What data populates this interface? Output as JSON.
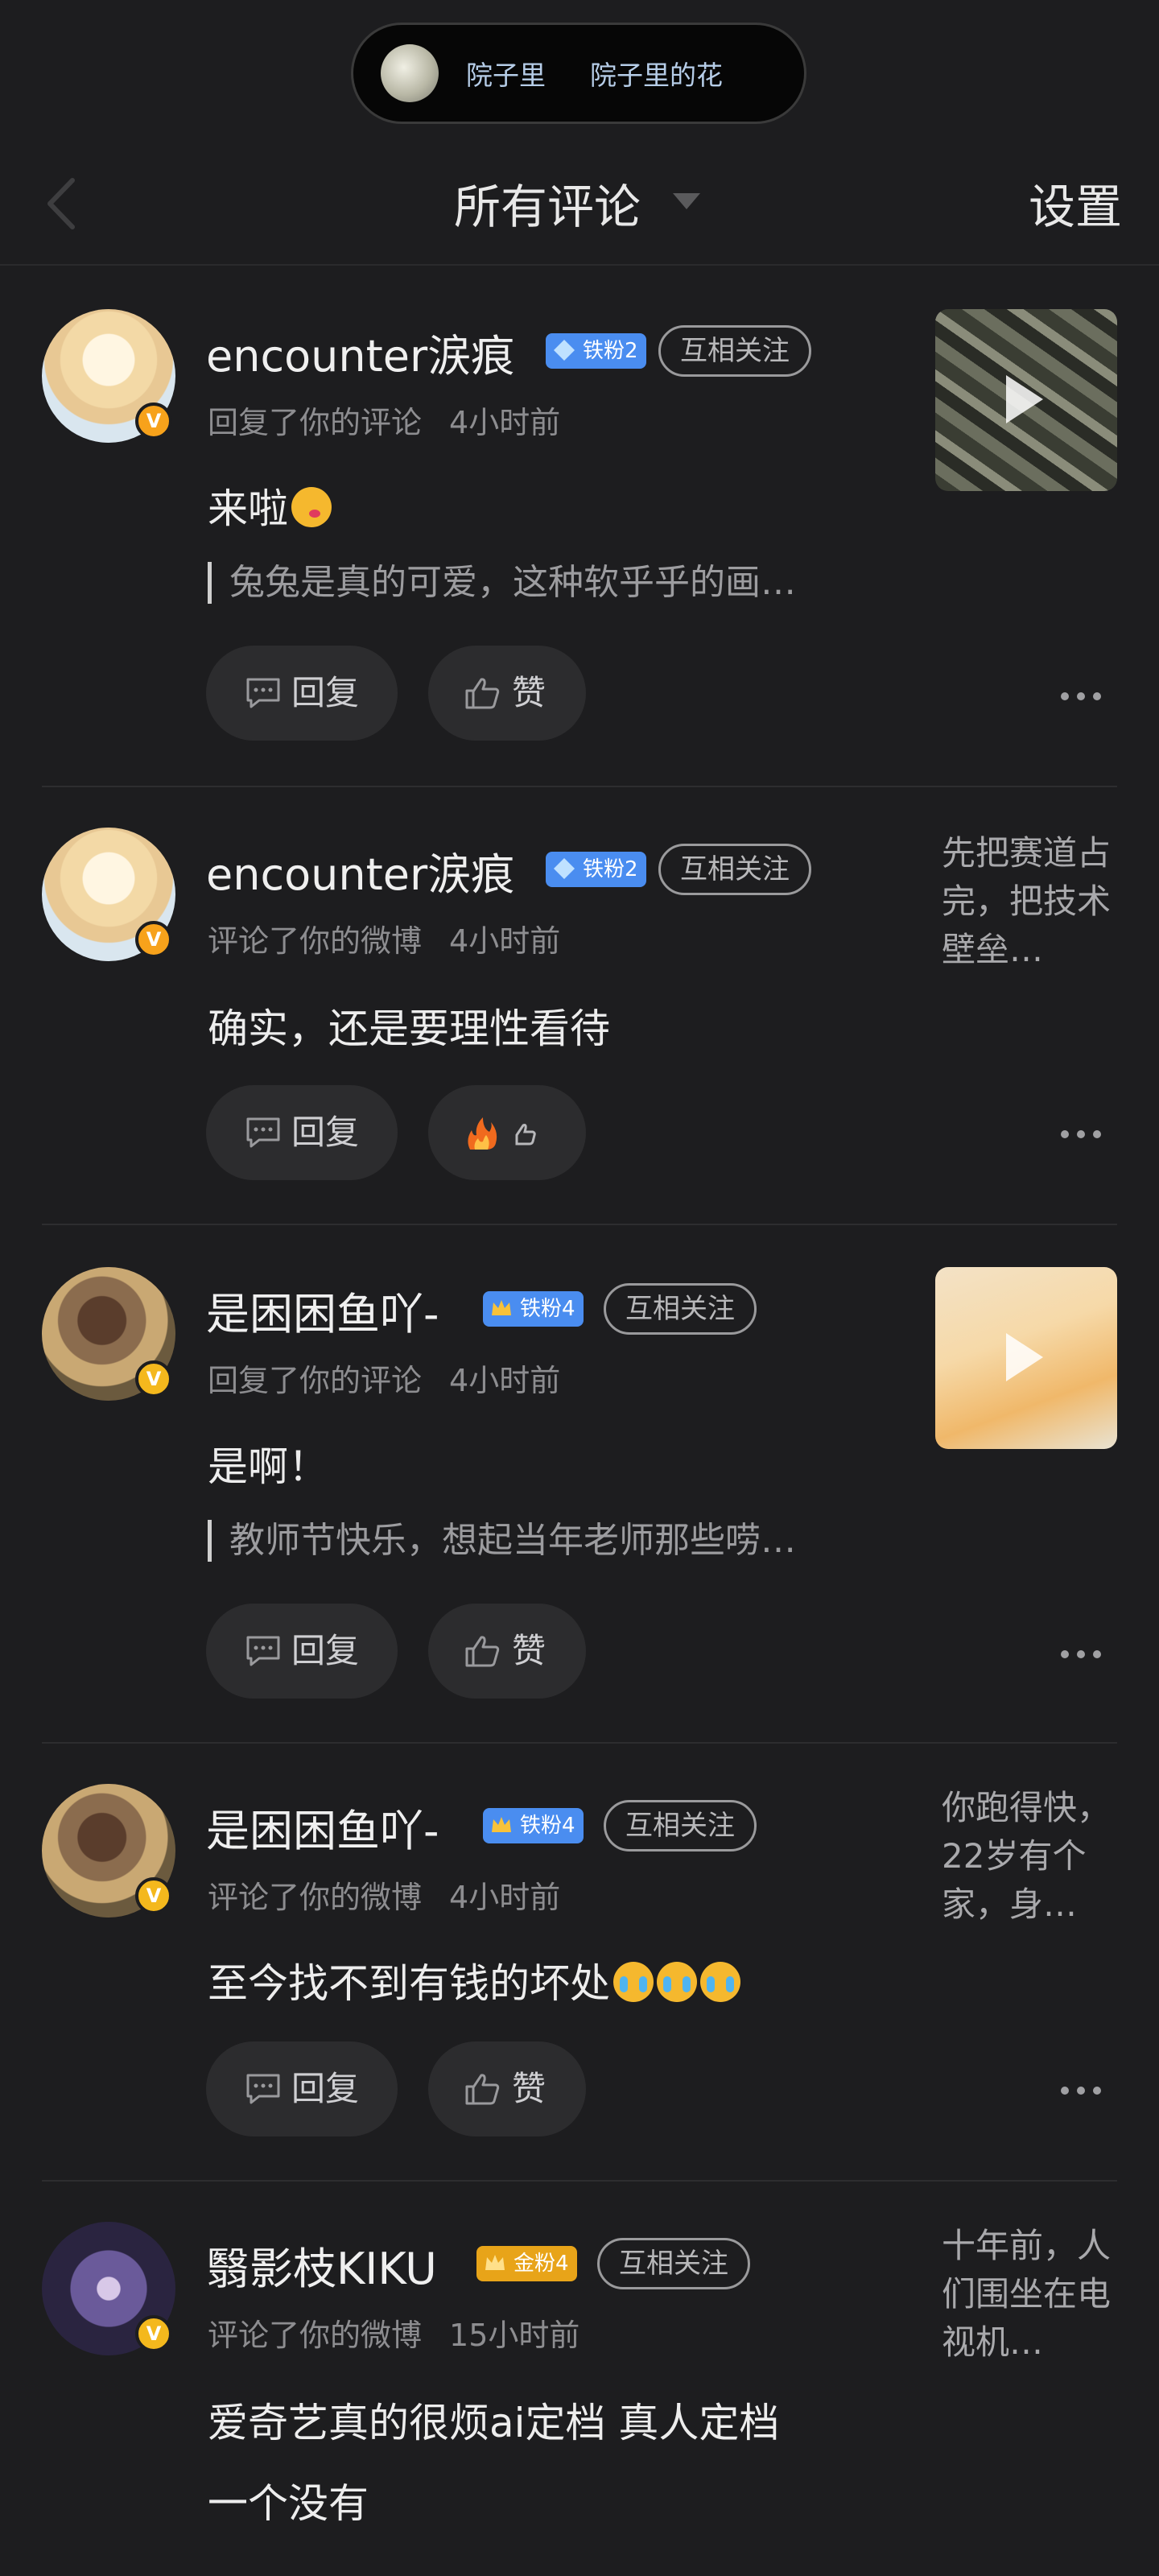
{
  "top_pill": {
    "text1": "院子里",
    "text2": "院子里的花"
  },
  "header": {
    "title": "所有评论",
    "settings": "设置"
  },
  "items": [
    {
      "username": "encounter涙痕",
      "fan_badge": "铁粉2",
      "follow_label": "互相关注",
      "action": "回复了你的评论",
      "time": "4小时前",
      "content": "来啦",
      "quote": "兔兔是真的可爱，这种软乎乎的画…",
      "reply_label": "回复",
      "like_label": "赞",
      "thumbnail": "video-thumbnail-camo"
    },
    {
      "username": "encounter涙痕",
      "fan_badge": "铁粉2",
      "follow_label": "互相关注",
      "action": "评论了你的微博",
      "time": "4小时前",
      "content": "确实，还是要理性看待",
      "reply_label": "回复",
      "side_text": "先把赛道占完，把技术壁垒…"
    },
    {
      "username": "是困困鱼吖-",
      "fan_badge": "铁粉4",
      "follow_label": "互相关注",
      "action": "回复了你的评论",
      "time": "4小时前",
      "content": "是啊！",
      "quote": "教师节快乐，想起当年老师那些唠…",
      "reply_label": "回复",
      "like_label": "赞",
      "thumbnail": "video-thumbnail-flowers"
    },
    {
      "username": "是困困鱼吖-",
      "fan_badge": "铁粉4",
      "follow_label": "互相关注",
      "action": "评论了你的微博",
      "time": "4小时前",
      "content": "至今找不到有钱的坏处",
      "reply_label": "回复",
      "like_label": "赞",
      "side_text": "你跑得快，22岁有个家，身…"
    },
    {
      "username": "翳影枝KIKU",
      "fan_badge": "金粉4",
      "follow_label": "互相关注",
      "action": "评论了你的微博",
      "time": "15小时前",
      "content": "爱奇艺真的很烦ai定档 真人定档",
      "content_line2": "一个没有",
      "side_text": "十年前，人们围坐在电视机…"
    }
  ],
  "colors": {
    "background": "#1d1d1f",
    "fan_blue": "#4a8df0",
    "fan_gold": "#e8a419",
    "v_badge": "#f7a21b"
  }
}
